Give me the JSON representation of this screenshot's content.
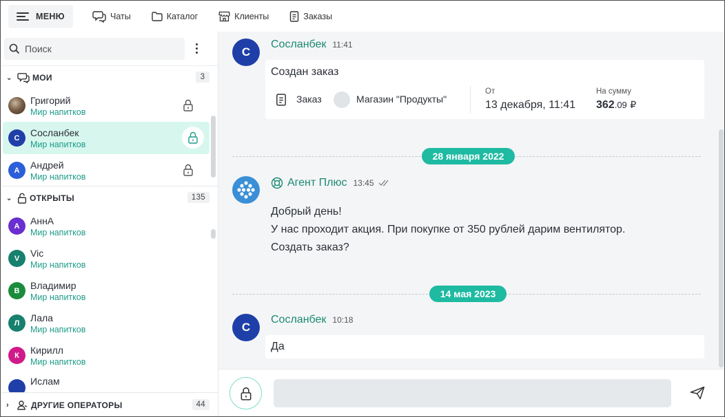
{
  "topbar": {
    "menu_label": "МЕНЮ",
    "nav": [
      {
        "label": "Чаты",
        "icon": "chats-icon"
      },
      {
        "label": "Каталог",
        "icon": "folder-icon"
      },
      {
        "label": "Клиенты",
        "icon": "store-icon"
      },
      {
        "label": "Заказы",
        "icon": "document-icon"
      }
    ]
  },
  "sidebar": {
    "search_placeholder": "Поиск",
    "mine": {
      "title": "МОИ",
      "count": "3"
    },
    "mine_contacts": [
      {
        "name": "Григорий",
        "sub": "Мир напитков",
        "initial": "",
        "color": "#6b5a4a"
      },
      {
        "name": "Сосланбек",
        "sub": "Мир напитков",
        "initial": "С",
        "color": "#1f3fa8"
      },
      {
        "name": "Андрей",
        "sub": "Мир напитков",
        "initial": "А",
        "color": "#2b5fd9"
      }
    ],
    "open": {
      "title": "ОТКРЫТЫ",
      "count": "135"
    },
    "open_contacts": [
      {
        "name": "АннА",
        "sub": "Мир напитков",
        "initial": "А",
        "color": "#6a2fd0"
      },
      {
        "name": "Vic",
        "sub": "Мир напитков",
        "initial": "V",
        "color": "#17806e"
      },
      {
        "name": "Владимир",
        "sub": "Мир напитков",
        "initial": "В",
        "color": "#1a8c3c"
      },
      {
        "name": "Лала",
        "sub": "Мир напитков",
        "initial": "Л",
        "color": "#17806e"
      },
      {
        "name": "Кирилл",
        "sub": "Мир напитков",
        "initial": "К",
        "color": "#d01a8a"
      },
      {
        "name": "Ислам",
        "sub": "",
        "initial": "",
        "color": "#1f3fa8"
      }
    ],
    "others": {
      "title": "ДРУГИЕ ОПЕРАТОРЫ",
      "count": "44"
    }
  },
  "chat": {
    "msg1": {
      "avatar": "С",
      "name": "Сосланбек",
      "time": "11:41",
      "text": "Создан заказ",
      "order": {
        "doc_label": "Заказ",
        "store": "Магазин \"Продукты\"",
        "from_label": "От",
        "from_value": "13 декабря, 11:41",
        "sum_label": "На сумму",
        "sum_int": "362",
        "sum_frac": ".09",
        "currency": "₽"
      }
    },
    "date1": "28 января 2022",
    "msg2": {
      "name": "Агент Плюс",
      "time": "13:45",
      "lines": [
        "Добрый день!",
        "У нас проходит акция. При покупке от 350 рублей дарим вентилятор.",
        "Создать заказ?"
      ]
    },
    "date2": "14 мая 2023",
    "msg3": {
      "avatar": "С",
      "name": "Сосланбек",
      "time": "10:18",
      "text": "Да"
    }
  },
  "colors": {
    "accent": "#1ebaa2",
    "name_green": "#1b8a72",
    "active_bg": "#d7f7ee",
    "avatar_blue": "#1f3fa8"
  }
}
